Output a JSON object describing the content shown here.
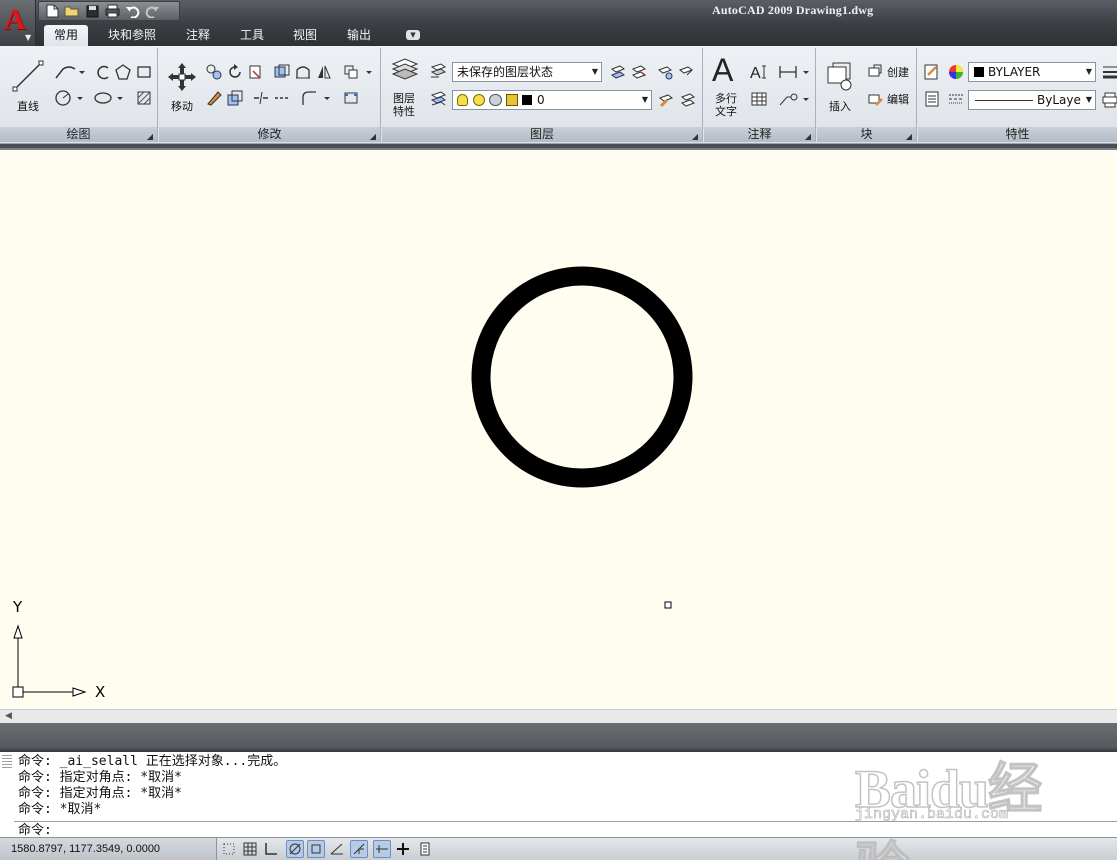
{
  "window": {
    "title": "AutoCAD 2009 Drawing1.dwg"
  },
  "app_button": {
    "logo": "A"
  },
  "quick_access": [
    "new-icon",
    "open-icon",
    "save-icon",
    "plot-icon",
    "undo-icon",
    "redo-icon"
  ],
  "tabs": [
    {
      "label": "常用",
      "active": true
    },
    {
      "label": "块和参照"
    },
    {
      "label": "注释"
    },
    {
      "label": "工具"
    },
    {
      "label": "视图"
    },
    {
      "label": "输出"
    }
  ],
  "ribbon": {
    "draw": {
      "title": "绘图",
      "line_label": "直线"
    },
    "modify": {
      "title": "修改",
      "move_label": "移动"
    },
    "layers": {
      "title": "图层",
      "props_label_1": "图层",
      "props_label_2": "特性",
      "layer_state": "未保存的图层状态",
      "current_layer": "0"
    },
    "annotation": {
      "title": "注释",
      "mtext_icon": "A",
      "mtext_label_1": "多行",
      "mtext_label_2": "文字"
    },
    "block": {
      "title": "块",
      "insert_label": "插入",
      "create_label": "创建",
      "edit_label": "编辑"
    },
    "properties": {
      "title": "特性",
      "color": "BYLAYER",
      "linetype": "ByLaye"
    }
  },
  "ucs": {
    "x_label": "X",
    "y_label": "Y"
  },
  "command": {
    "history": [
      "命令: _ai_selall 正在选择对象...完成。",
      "命令: 指定对角点: *取消*",
      "命令: 指定对角点: *取消*",
      "命令: *取消*"
    ],
    "prompt": "命令:"
  },
  "status": {
    "coords": "1580.8797, 1177.3549, 0.0000"
  },
  "watermark": {
    "brand": "Baidu经验",
    "url": "jingyan.baidu.com"
  },
  "colors": {
    "canvas": "#fffcf0",
    "logo_red": "#d21c1c",
    "circle": "#000000"
  }
}
